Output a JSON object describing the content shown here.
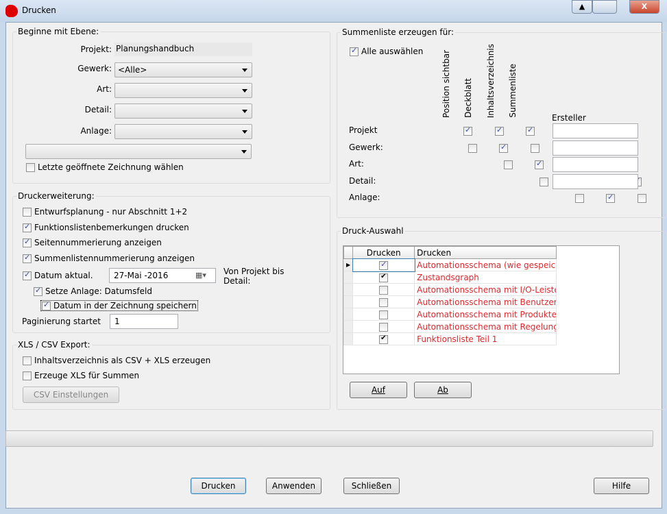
{
  "window": {
    "title": "Drucken",
    "ctrl_up": "▲",
    "ctrl_close": "X"
  },
  "ebene": {
    "legend": "Beginne mit Ebene:",
    "projekt_label": "Projekt:",
    "projekt_value": "Planungshandbuch",
    "gewerk_label": "Gewerk:",
    "gewerk_value": "<Alle>",
    "art_label": "Art:",
    "detail_label": "Detail:",
    "anlage_label": "Anlage:",
    "letzte_label": "Letzte geöffnete Zeichnung wählen"
  },
  "drucker": {
    "legend": "Druckerweiterung:",
    "items": [
      "Entwurfsplanung - nur Abschnitt 1+2",
      "Funktionslistenbemerkungen drucken",
      "Seitennummerierung anzeigen",
      "Summenlistennummerierung anzeigen"
    ],
    "datum_label": "Datum aktual.",
    "datum_value": "27-Mai -2016",
    "von_projekt": "Von Projekt bis Detail:",
    "setze_label": "Setze Anlage: Datumsfeld",
    "speichern_label": "Datum in der Zeichnung speichern",
    "paginierung_label": "Paginierung startet",
    "paginierung_value": "1"
  },
  "xls": {
    "legend": "XLS / CSV Export:",
    "inhalt_label": "Inhaltsverzeichnis als CSV + XLS erzeugen",
    "summen_label": "Erzeuge XLS für Summen",
    "csv_button": "CSV Einstellungen"
  },
  "summen": {
    "legend": "Summenliste erzeugen für:",
    "alle_label": "Alle auswählen",
    "columns": [
      "Position sichtbar",
      "Deckblatt",
      "Inhaltsverzeichnis",
      "Summenliste"
    ],
    "ersteller_label": "Ersteller",
    "rows": [
      {
        "label": "Projekt",
        "checks": [
          null,
          true,
          true,
          true
        ]
      },
      {
        "label": "Gewerk:",
        "checks": [
          false,
          true,
          false,
          true
        ]
      },
      {
        "label": "Art:",
        "checks": [
          false,
          true,
          false,
          true
        ]
      },
      {
        "label": "Detail:",
        "checks": [
          false,
          true,
          false,
          true
        ]
      },
      {
        "label": "Anlage:",
        "checks": [
          false,
          true,
          false,
          true
        ]
      }
    ]
  },
  "auswahl": {
    "legend": "Druck-Auswahl",
    "col1": "Drucken",
    "col2": "Drucken",
    "rows": [
      {
        "checked": true,
        "label": "Automationsschema (wie gespeichert)"
      },
      {
        "checked": true,
        "label": "Zustandsgraph"
      },
      {
        "checked": false,
        "label": "Automationsschema mit I/O-Leisten"
      },
      {
        "checked": false,
        "label": "Automationsschema mit Benutzerschlü"
      },
      {
        "checked": false,
        "label": "Automationsschema mit Produkten"
      },
      {
        "checked": false,
        "label": "Automationsschema mit Regelung"
      },
      {
        "checked": true,
        "label": "Funktionsliste Teil 1"
      }
    ],
    "auf": "Auf",
    "ab": "Ab"
  },
  "buttons": {
    "drucken": "Drucken",
    "anwenden": "Anwenden",
    "schliessen": "Schließen",
    "hilfe": "Hilfe"
  }
}
